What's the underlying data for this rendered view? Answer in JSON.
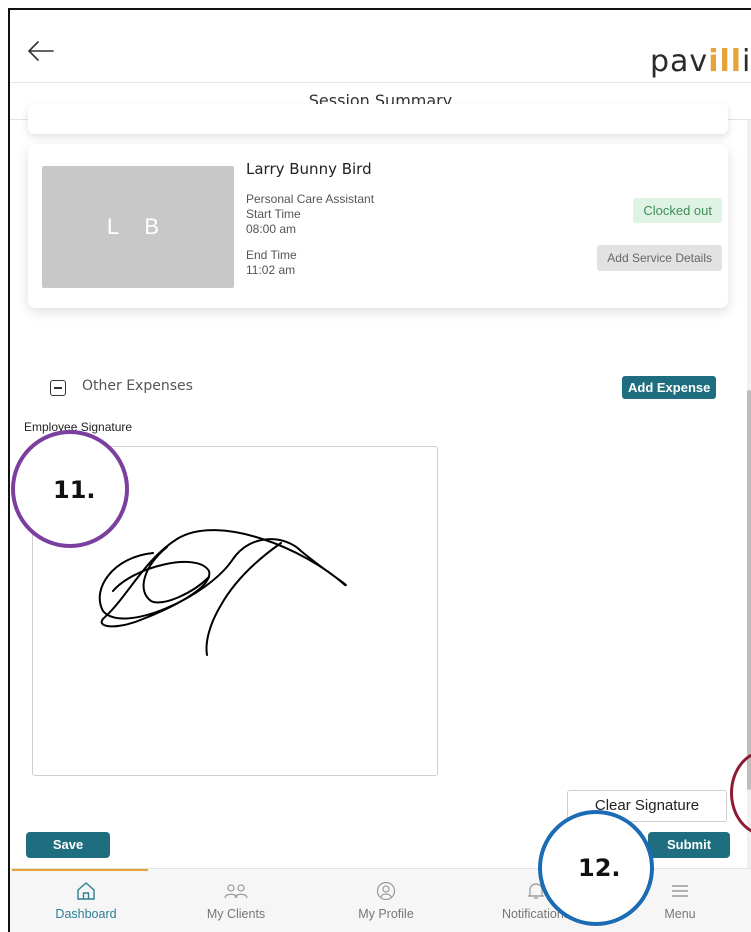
{
  "header": {
    "brand_prefix": "pav",
    "brand_accent": "ill",
    "brand_suffix": "io"
  },
  "subheader": {
    "title": "Session Summary"
  },
  "session_card": {
    "avatar_initials": "L B",
    "name": "Larry Bunny Bird",
    "role": "Personal Care Assistant",
    "start_label": "Start Time",
    "start_value": "08:00 am",
    "end_label": "End Time",
    "end_value": "11:02 am",
    "status": "Clocked out",
    "service_button": "Add Service Details"
  },
  "expenses": {
    "label": "Other Expenses",
    "add_button": "Add Expense"
  },
  "signature": {
    "label": "Employee Signature",
    "clear_button": "Clear Signature"
  },
  "actions": {
    "save": "Save",
    "submit": "Submit"
  },
  "annotations": {
    "eleven": "11.",
    "twelve": "12."
  },
  "nav": [
    {
      "label": "Dashboard",
      "icon": "home-icon",
      "active": true
    },
    {
      "label": "My Clients",
      "icon": "people-icon",
      "active": false
    },
    {
      "label": "My Profile",
      "icon": "profile-icon",
      "active": false
    },
    {
      "label": "Notifications",
      "icon": "bell-icon",
      "active": false
    },
    {
      "label": "Menu",
      "icon": "menu-icon",
      "active": false
    }
  ],
  "colors": {
    "primary": "#1f6e80",
    "accent": "#e8a23a",
    "status_bg": "#dff3e4",
    "status_text": "#3d8f55",
    "annotation_11": "#7b3fa0",
    "annotation_12": "#1c6bb5",
    "annotation_other": "#8e1b33"
  }
}
